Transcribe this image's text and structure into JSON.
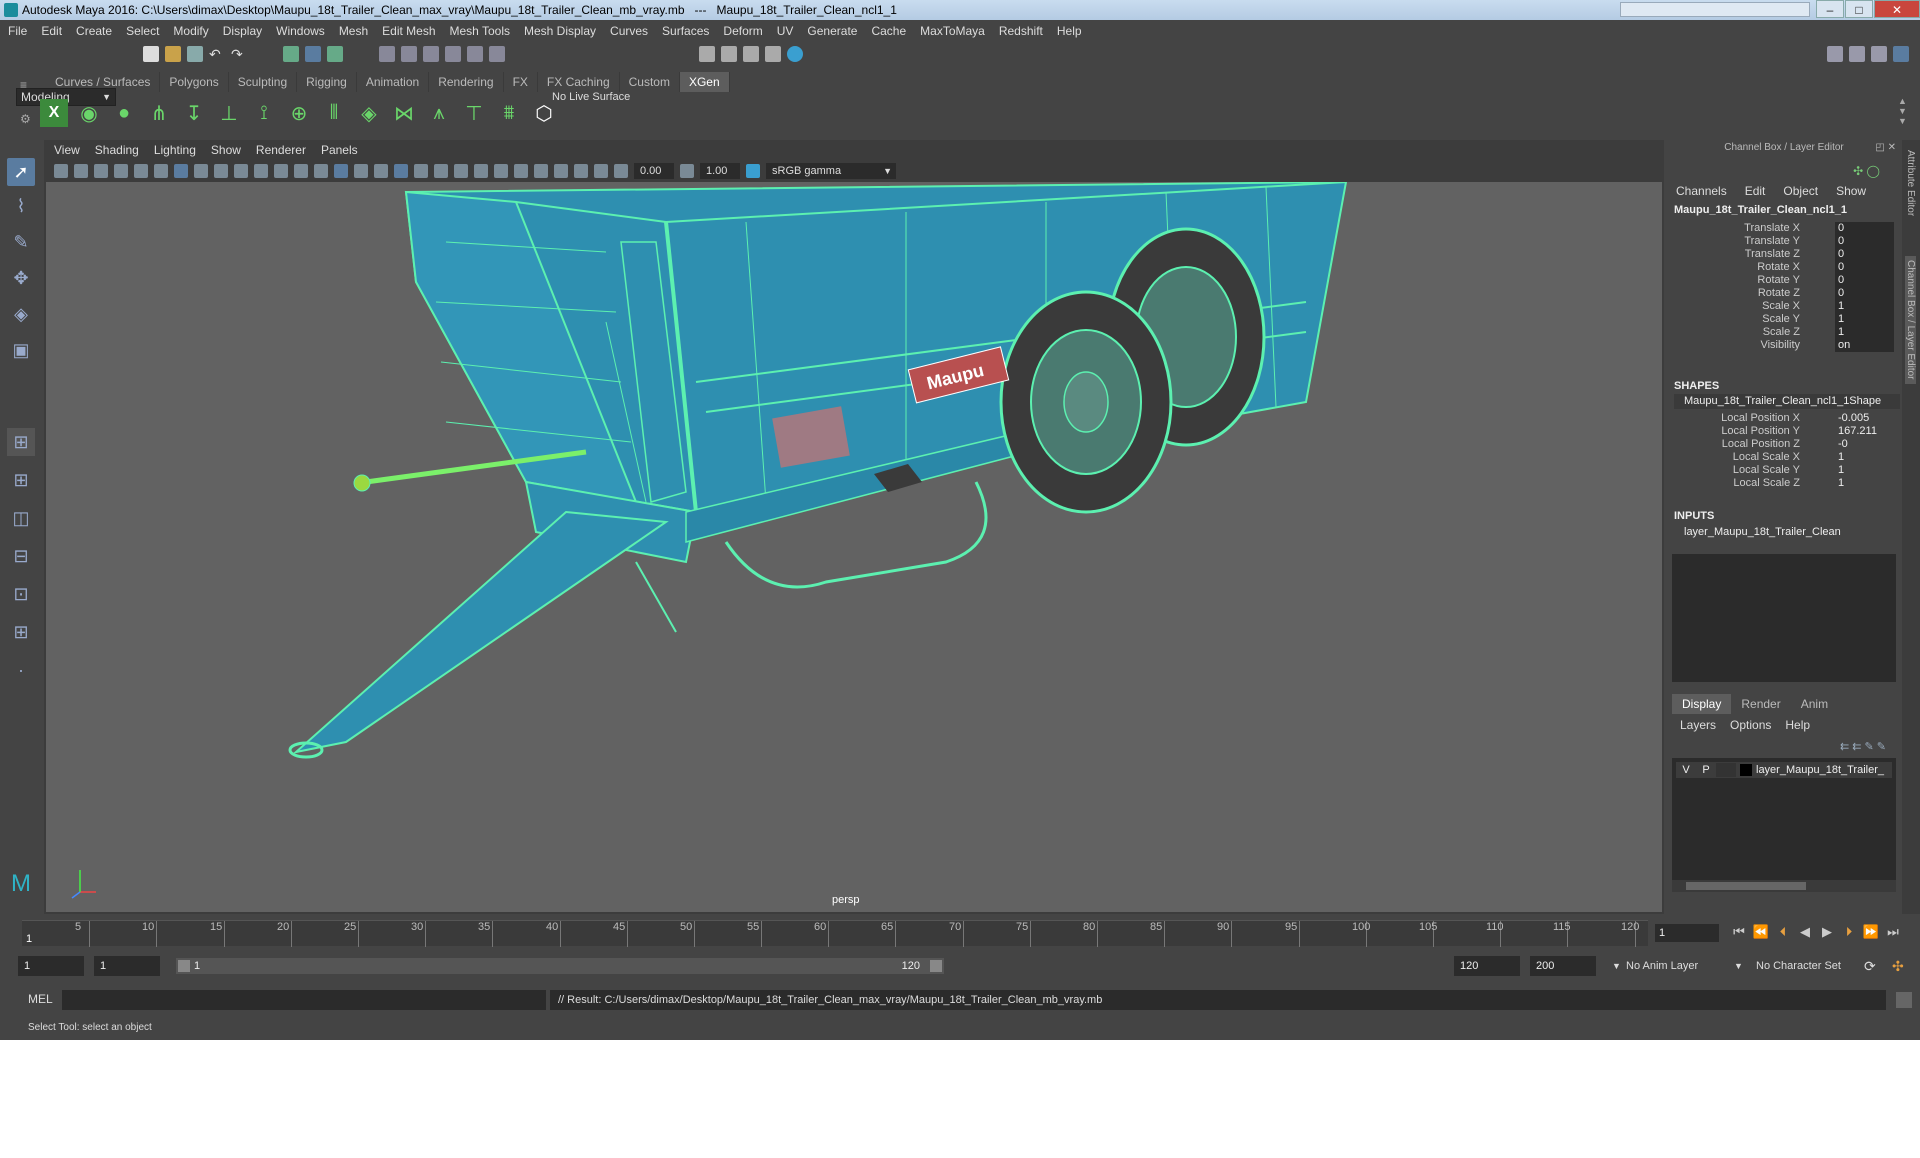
{
  "title": {
    "app": "Autodesk Maya 2016: C:\\Users\\dimax\\Desktop\\Maupu_18t_Trailer_Clean_max_vray\\Maupu_18t_Trailer_Clean_mb_vray.mb",
    "sep": "---",
    "object": "Maupu_18t_Trailer_Clean_ncl1_1"
  },
  "menu": [
    "File",
    "Edit",
    "Create",
    "Select",
    "Modify",
    "Display",
    "Windows",
    "Mesh",
    "Edit Mesh",
    "Mesh Tools",
    "Mesh Display",
    "Curves",
    "Surfaces",
    "Deform",
    "UV",
    "Generate",
    "Cache",
    "MaxToMaya",
    "Redshift",
    "Help"
  ],
  "mode": "Modeling",
  "live_surface": "No Live Surface",
  "shelf_tabs": [
    "Curves / Surfaces",
    "Polygons",
    "Sculpting",
    "Rigging",
    "Animation",
    "Rendering",
    "FX",
    "FX Caching",
    "Custom",
    "XGen"
  ],
  "active_shelf_tab": "XGen",
  "panel_menu": [
    "View",
    "Shading",
    "Lighting",
    "Show",
    "Renderer",
    "Panels"
  ],
  "viewport": {
    "exposure": "0.00",
    "gamma_value": "1.00",
    "color_space": "sRGB gamma",
    "camera": "persp",
    "logo_text": "Maupu"
  },
  "channel_box": {
    "header": "Channel Box / Layer Editor",
    "menu": [
      "Channels",
      "Edit",
      "Object",
      "Show"
    ],
    "object_name": "Maupu_18t_Trailer_Clean_ncl1_1",
    "attrs": [
      {
        "label": "Translate X",
        "value": "0"
      },
      {
        "label": "Translate Y",
        "value": "0"
      },
      {
        "label": "Translate Z",
        "value": "0"
      },
      {
        "label": "Rotate X",
        "value": "0"
      },
      {
        "label": "Rotate Y",
        "value": "0"
      },
      {
        "label": "Rotate Z",
        "value": "0"
      },
      {
        "label": "Scale X",
        "value": "1"
      },
      {
        "label": "Scale Y",
        "value": "1"
      },
      {
        "label": "Scale Z",
        "value": "1"
      },
      {
        "label": "Visibility",
        "value": "on"
      }
    ],
    "shapes_title": "SHAPES",
    "shape_name": "Maupu_18t_Trailer_Clean_ncl1_1Shape",
    "shape_attrs": [
      {
        "label": "Local Position X",
        "value": "-0.005"
      },
      {
        "label": "Local Position Y",
        "value": "167.211"
      },
      {
        "label": "Local Position Z",
        "value": "-0"
      },
      {
        "label": "Local Scale X",
        "value": "1"
      },
      {
        "label": "Local Scale Y",
        "value": "1"
      },
      {
        "label": "Local Scale Z",
        "value": "1"
      }
    ],
    "inputs_title": "INPUTS",
    "input_name": "layer_Maupu_18t_Trailer_Clean"
  },
  "layer_editor": {
    "tabs": [
      "Display",
      "Render",
      "Anim"
    ],
    "active_tab": "Display",
    "menu": [
      "Layers",
      "Options",
      "Help"
    ],
    "layer": {
      "v": "V",
      "p": "P",
      "name": "layer_Maupu_18t_Trailer_"
    }
  },
  "side_tabs": [
    "Attribute Editor",
    "Channel Box / Layer Editor"
  ],
  "timeline": {
    "ticks": [
      "5",
      "10",
      "15",
      "20",
      "25",
      "30",
      "35",
      "40",
      "45",
      "50",
      "55",
      "60",
      "65",
      "70",
      "75",
      "80",
      "85",
      "90",
      "95",
      "100",
      "105",
      "110",
      "115",
      "120"
    ],
    "start_label": "1",
    "current_frame": "1"
  },
  "range": {
    "start": "1",
    "playback_start": "1",
    "slider_start": "1",
    "slider_end": "120",
    "playback_end": "120",
    "end": "200",
    "anim_layer": "No Anim Layer",
    "char_set": "No Character Set"
  },
  "command": {
    "label": "MEL",
    "result": "// Result: C:/Users/dimax/Desktop/Maupu_18t_Trailer_Clean_max_vray/Maupu_18t_Trailer_Clean_mb_vray.mb"
  },
  "help_line": "Select Tool: select an object",
  "colors": {
    "wire": "#5cf0b0",
    "body": "#2e8fb0",
    "accent": "#5a7ca0"
  }
}
